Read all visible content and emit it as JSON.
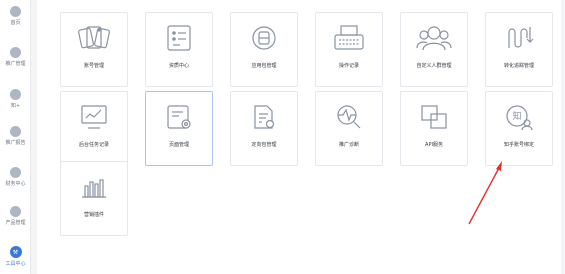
{
  "sidebar": {
    "items": [
      {
        "label": "首页",
        "icon": "home-icon",
        "glyph": "",
        "active": false
      },
      {
        "label": "推广管理",
        "icon": "promotion-icon",
        "glyph": "",
        "active": false
      },
      {
        "label": "知+",
        "icon": "zhiplus-icon",
        "glyph": "",
        "active": false
      },
      {
        "label": "推广报告",
        "icon": "report-icon",
        "glyph": "",
        "active": false
      },
      {
        "label": "财务中心",
        "icon": "finance-icon",
        "glyph": "",
        "active": false
      },
      {
        "label": "产品管理",
        "icon": "product-icon",
        "glyph": "",
        "active": false
      },
      {
        "label": "工具中心",
        "icon": "tools-icon",
        "glyph": "⚒",
        "active": true
      }
    ]
  },
  "tools": [
    {
      "label": "账号管理",
      "icon": "account-cards-icon"
    },
    {
      "label": "资质中心",
      "icon": "qualification-list-icon"
    },
    {
      "label": "应用包管理",
      "icon": "app-package-icon"
    },
    {
      "label": "操作记录",
      "icon": "typewriter-icon"
    },
    {
      "label": "自定义人群管理",
      "icon": "custom-audience-icon"
    },
    {
      "label": "转化追踪管理",
      "icon": "conversion-tracking-icon"
    },
    {
      "label": "后台任务记录",
      "icon": "task-monitor-icon"
    },
    {
      "label": "页面管理",
      "icon": "page-settings-icon"
    },
    {
      "label": "定向包管理",
      "icon": "targeting-package-icon"
    },
    {
      "label": "推广诊断",
      "icon": "diagnosis-icon"
    },
    {
      "label": "API服务",
      "icon": "api-service-icon"
    },
    {
      "label": "知乎账号绑定",
      "icon": "zhihu-account-binding-icon",
      "badge": "知"
    },
    {
      "label": "营销插件",
      "icon": "marketing-plugin-icon"
    }
  ],
  "colors": {
    "icon_stroke": "#8a93a0",
    "accent": "#3a78d8",
    "annotation_arrow": "#e0332c"
  }
}
